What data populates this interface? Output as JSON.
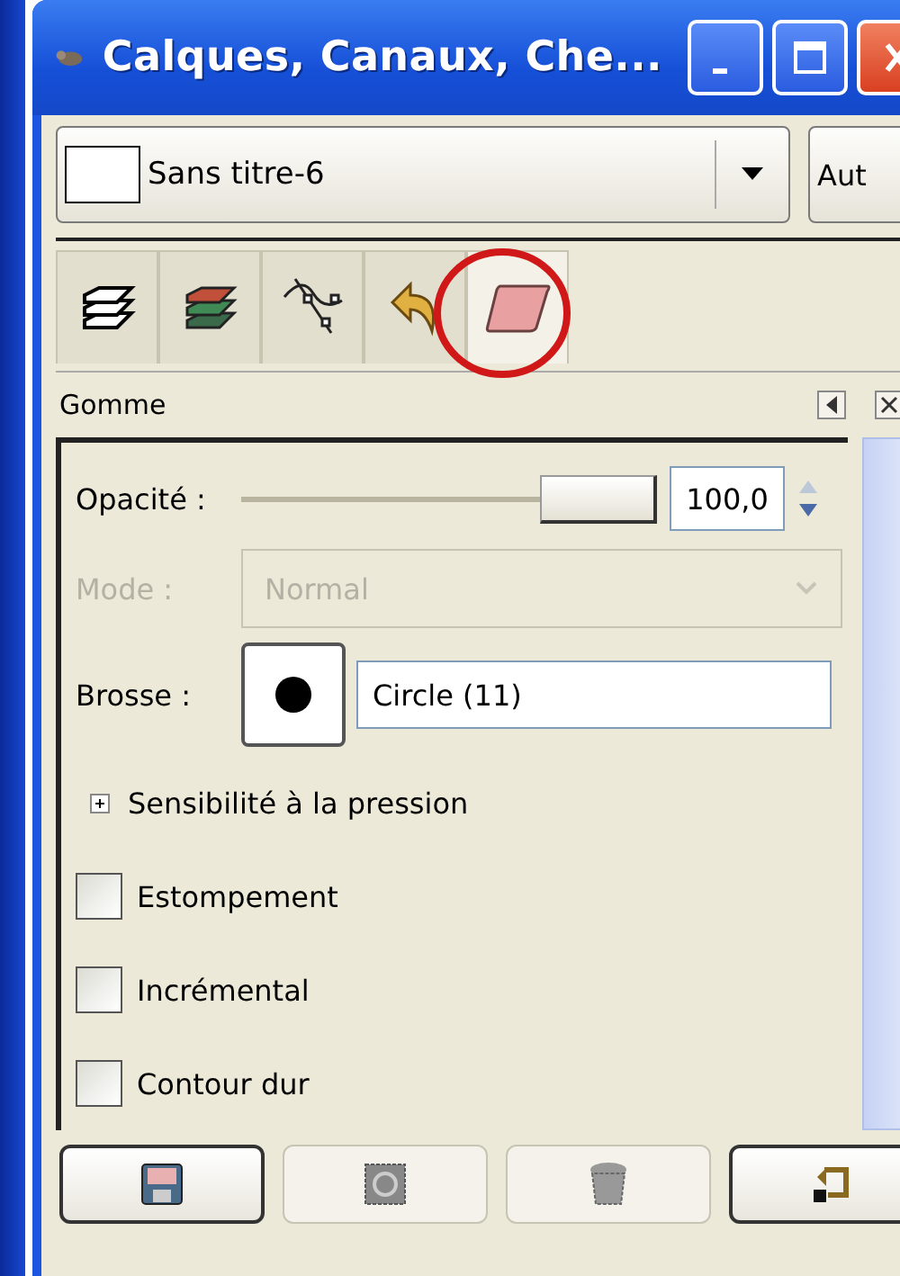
{
  "window": {
    "title": "Calques, Canaux, Che..."
  },
  "image_combo": {
    "value": "Sans titre-6",
    "auto_button": "Aut"
  },
  "tabs": [
    {
      "kind": "layers",
      "selected": false
    },
    {
      "kind": "channels",
      "selected": false
    },
    {
      "kind": "paths",
      "selected": false
    },
    {
      "kind": "undo",
      "selected": false
    },
    {
      "kind": "eraser",
      "selected": true
    }
  ],
  "panel": {
    "title": "Gomme",
    "opacity": {
      "label": "Opacité :",
      "level": 1.0,
      "value": "100,0"
    },
    "mode": {
      "label": "Mode :",
      "value": "Normal",
      "disabled": true
    },
    "brush": {
      "label": "Brosse :",
      "value": "Circle (11)"
    },
    "pressure": {
      "label": "Sensibilité à la pression",
      "expanded": false
    },
    "options": [
      {
        "label": "Estompement",
        "checked": false
      },
      {
        "label": "Incrémental",
        "checked": false
      },
      {
        "label": "Contour dur",
        "checked": false
      }
    ]
  },
  "buttons": [
    {
      "kind": "save",
      "disabled": false
    },
    {
      "kind": "restore",
      "disabled": true
    },
    {
      "kind": "delete",
      "disabled": true
    },
    {
      "kind": "reset",
      "disabled": false
    }
  ]
}
